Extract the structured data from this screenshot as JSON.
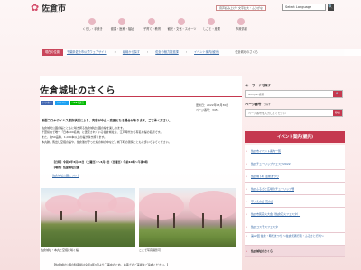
{
  "header": {
    "logo_title": "佐倉市",
    "logo_sub": "SAKURA CITY",
    "util_buttons": [
      "音声読み上げ・文字拡大・ふりがな",
      "Select Language"
    ],
    "search_button": "🔍"
  },
  "gnav": [
    "くらし・手続き",
    "健康・医療・福祉",
    "子育て・教育",
    "観光・文化・スポーツ",
    "しごと・産業",
    "市政情報"
  ],
  "breadcrumb": [
    "現在の位置",
    "千葉県佐倉市公式ウェブサイト",
    "組織から探す",
    "佐倉の魅力推進課",
    "イベント案内(観光)",
    "佐倉城址のさくら"
  ],
  "page": {
    "title": "佐倉城址のさくら",
    "share": [
      "いいね 0",
      "ツイート",
      "LINEで送る"
    ],
    "updated": "更新日：2022年03月30日",
    "page_no": "ページ番号：3451",
    "lead": "新型コロナウイルス感染状況により、内容が中止・変更となる場合があります。ご了承ください。",
    "body": [
      "佐倉城址公園の桜とともに咲き誇る佐倉城址公園の桜を楽しめます。",
      "千葉県内で唯一「日本100名城」に選定されている佐倉城址は、江戸時代から有名な桜の名所です。",
      "また、約50品種、1,000本以上の桜が咲き誇ります。",
      "本丸跡、馬出し空堀の桜や、佐倉藩が守った桜の林の中など、城下町の風情とともに歩いてみてください。"
    ],
    "info": [
      "【日時】令和4年3月26日（土曜日）～4月3日（日曜日）午前10時～午後4時",
      "【場所】佐倉城址公園"
    ],
    "pdf_link": "佐倉城址公園について",
    "captions": [
      "佐倉城址・本丸と空堀に咲く桜",
      "ここで写真撮影可"
    ],
    "note": "【佐倉城址公園の駐車場は令和4年3月より工事中のため、お車でのご来場はご遠慮ください。】"
  },
  "sidebar": {
    "keyword_label": "キーワードで探す",
    "keyword_sub": "",
    "keyword_placeholder": "Google 検索",
    "pageno_label": "ページ番号",
    "pageno_sub": "で探す",
    "pageno_placeholder": "ページ番号を入力してください",
    "go": "移動",
    "event_head": "イベント案内(観光)",
    "events": [
      "佐倉市イベント案内一覧",
      "佐倉チューリップフェスタ2022",
      "佐倉城下町 恵隆まつり",
      "佐倉ふるさと広場のチューリップ畑",
      "草ぶえの丘 花の丘",
      "佐倉市民花火大会（佐倉花火フェスタ）",
      "佐倉コスモスフェスタ",
      "第22回 佐倉・時代まつり ～佐倉武者行列・ふるさと行列～",
      "佐倉城址のさくら"
    ],
    "active_index": 8
  }
}
